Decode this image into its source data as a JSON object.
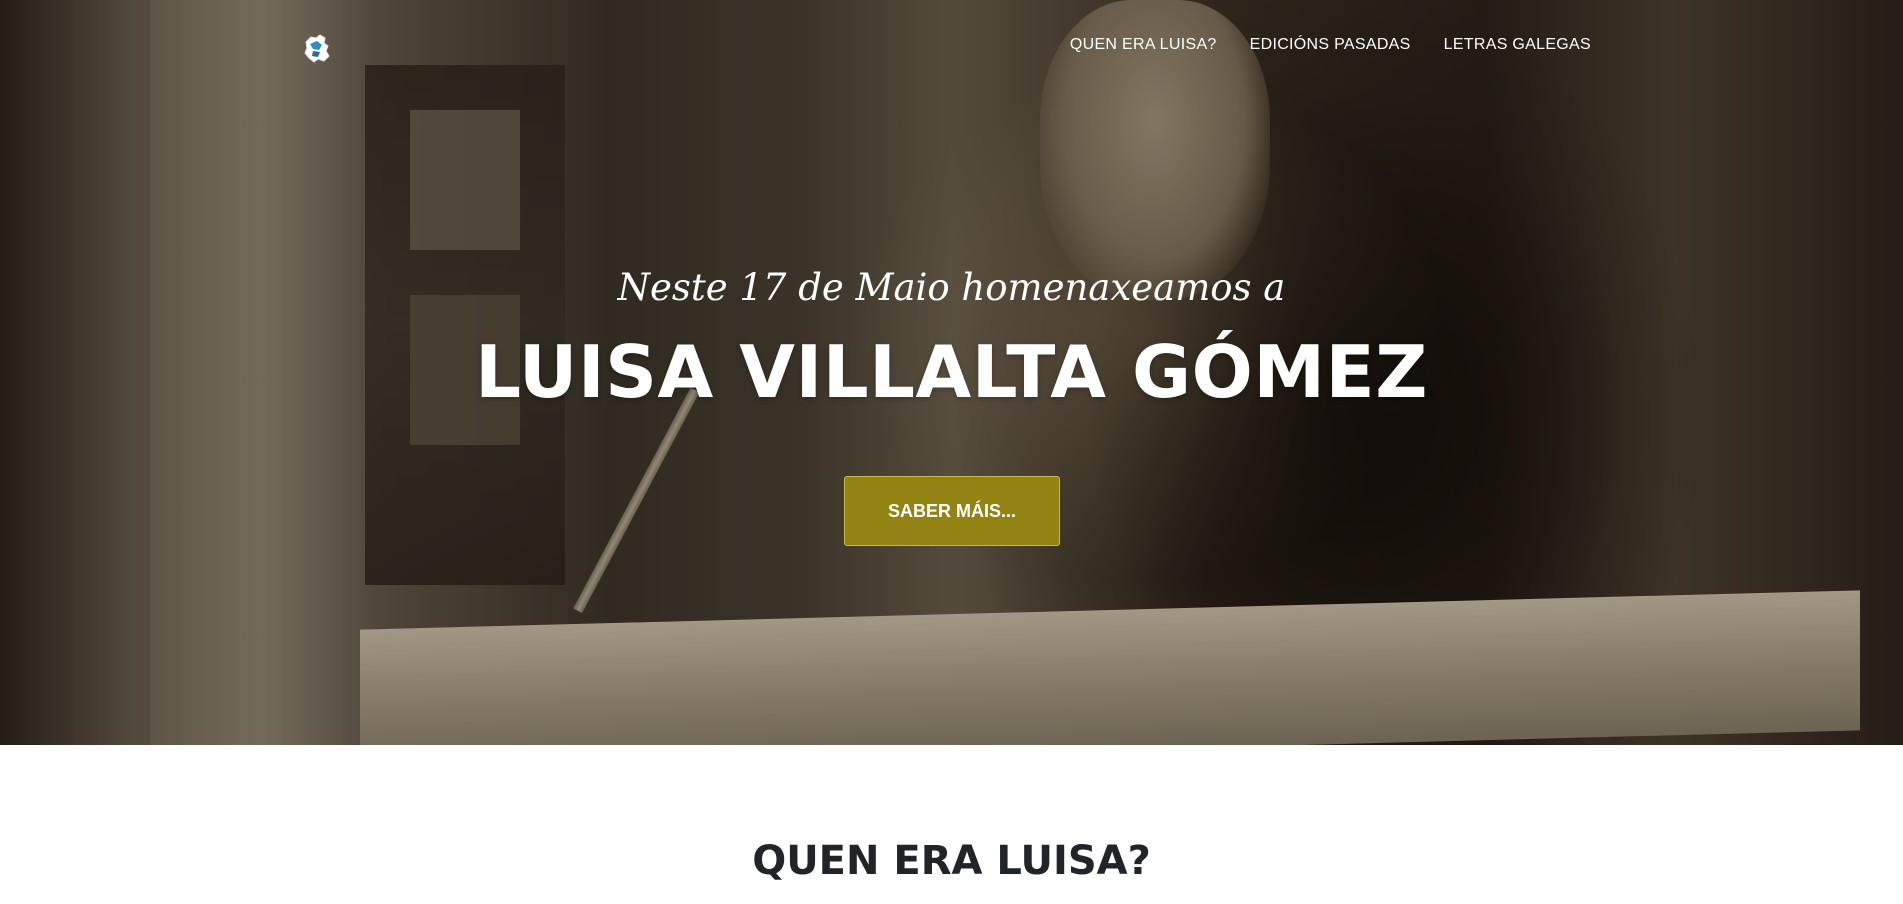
{
  "nav": {
    "items": [
      {
        "label": "QUEN ERA LUISA?"
      },
      {
        "label": "EDICIÓNS PASADAS"
      },
      {
        "label": "LETRAS GALEGAS"
      }
    ]
  },
  "hero": {
    "tagline": "Neste 17 de Maio homenaxeamos a",
    "headline": "LUISA VILLALTA GÓMEZ",
    "cta_label": "SABER MÁIS..."
  },
  "section": {
    "title": "QUEN ERA LUISA?"
  },
  "colors": {
    "cta_background": "#928313",
    "section_title": "#212529",
    "nav_text": "#ffffff"
  },
  "icons": {
    "logo": "galicia-map-logo"
  }
}
